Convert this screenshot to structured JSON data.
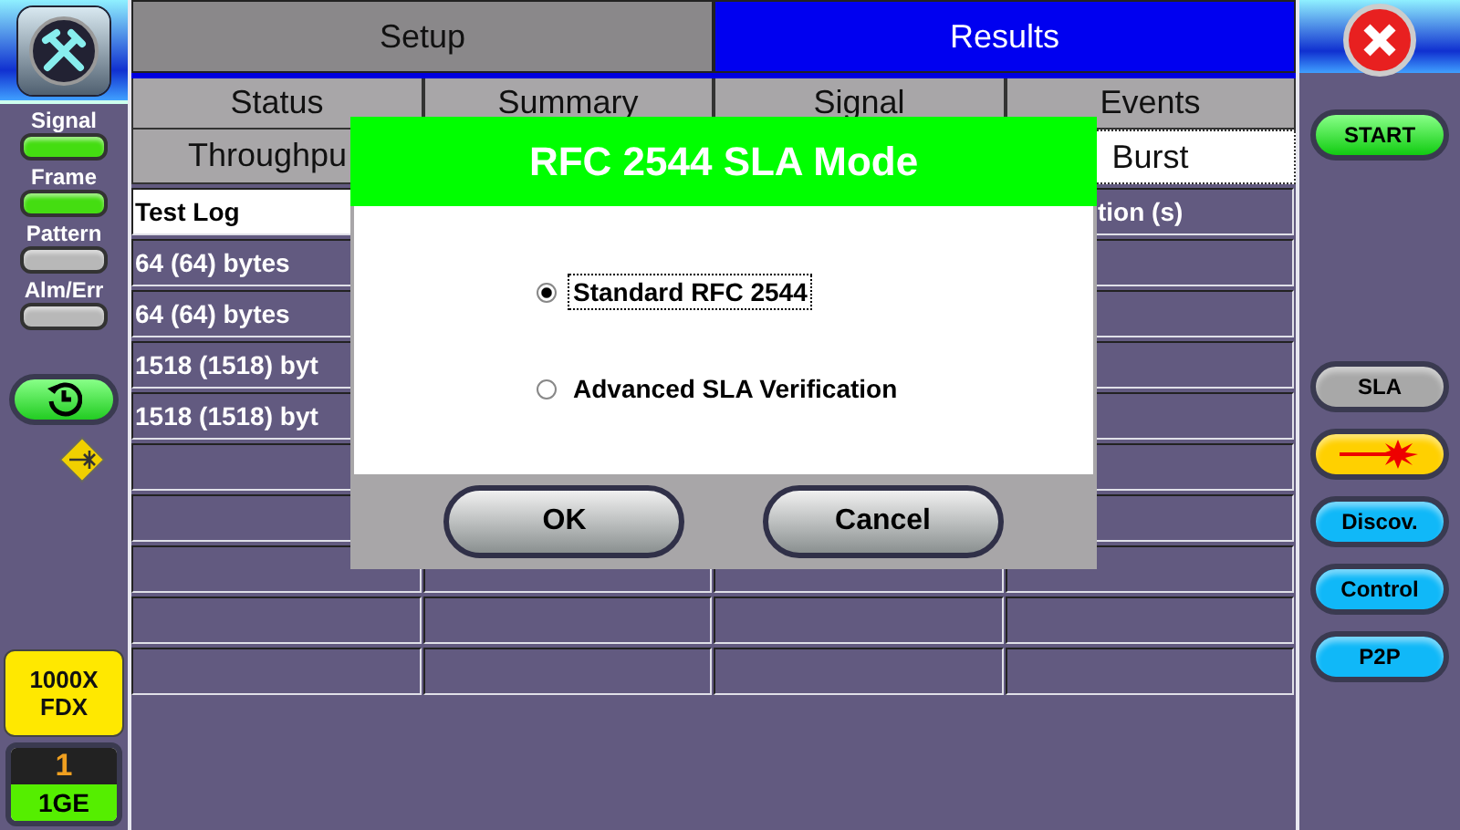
{
  "left_panel": {
    "indicators": [
      {
        "label": "Signal",
        "color": "#44dd11"
      },
      {
        "label": "Frame",
        "color": "#44dd11"
      },
      {
        "label": "Pattern",
        "color": "#b8b8b8"
      },
      {
        "label": "Alm/Err",
        "color": "#b8b8b8"
      }
    ],
    "interface_badge": [
      "1000X",
      "FDX"
    ],
    "port": {
      "number": "1",
      "label": "1GE"
    }
  },
  "tabs": [
    {
      "label": "Setup",
      "selected": false
    },
    {
      "label": "Results",
      "selected": true
    }
  ],
  "subtabs": [
    {
      "label": "Status",
      "selected": false
    },
    {
      "label": "Summary",
      "selected": false
    },
    {
      "label": "Signal",
      "selected": false
    },
    {
      "label": "Events",
      "selected": false
    }
  ],
  "subtabs_row2": [
    {
      "label": "Throughpu",
      "selected": false
    },
    {
      "label": "Burst",
      "selected": true
    }
  ],
  "table": {
    "headers": [
      "Test Log",
      "tion (s)"
    ],
    "rows": [
      "64 (64) bytes",
      "64 (64) bytes",
      "1518 (1518) byt",
      "1518 (1518) byt"
    ]
  },
  "dialog": {
    "title": "RFC 2544 SLA Mode",
    "options": [
      {
        "label": "Standard RFC 2544",
        "selected": true
      },
      {
        "label": "Advanced SLA Verification",
        "selected": false
      }
    ],
    "buttons": [
      "OK",
      "Cancel"
    ]
  },
  "right_panel": {
    "start": "START",
    "buttons": [
      {
        "kind": "text",
        "label": "SLA",
        "color": "#a8a8a8"
      },
      {
        "kind": "laser",
        "color": "#ffd000"
      },
      {
        "kind": "text",
        "label": "Discov.",
        "color": "#10b8f8"
      },
      {
        "kind": "text",
        "label": "Control",
        "color": "#10b8f8"
      },
      {
        "kind": "text",
        "label": "P2P",
        "color": "#10b8f8"
      }
    ]
  }
}
